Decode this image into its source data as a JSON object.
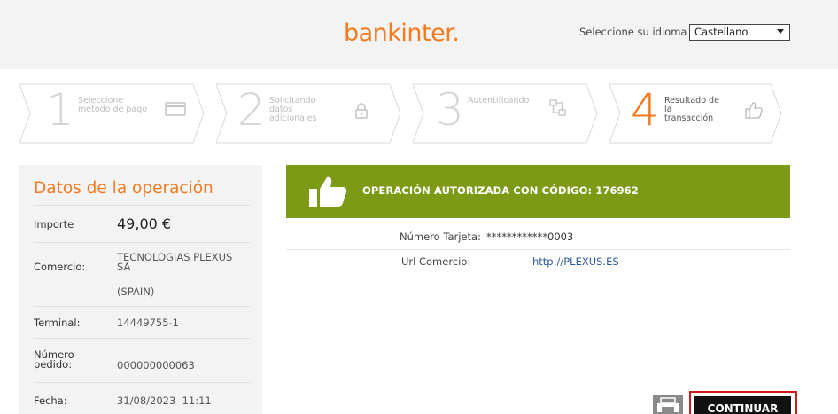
{
  "header": {
    "logo_text": "bankinter.",
    "language_label": "Seleccione su idioma",
    "language_selected": "Castellano"
  },
  "steps": [
    {
      "number": "1",
      "label_lines": [
        "Seleccione",
        "método de pago"
      ],
      "icon": "credit-card-icon",
      "active": false
    },
    {
      "number": "2",
      "label_lines": [
        "Solicitando",
        "datos",
        "adicionales"
      ],
      "icon": "lock-icon",
      "active": false
    },
    {
      "number": "3",
      "label_lines": [
        "Autentificando"
      ],
      "icon": "network-icon",
      "active": false
    },
    {
      "number": "4",
      "label_lines": [
        "Resultado de",
        "la",
        "transacción"
      ],
      "icon": "thumbs-up-icon",
      "active": true
    }
  ],
  "operation": {
    "title": "Datos de la operación",
    "rows": [
      {
        "label": "Importe",
        "value": "49,00 €"
      },
      {
        "label": "Comercio:",
        "value_lines": [
          "TECNOLOGIAS PLEXUS",
          "SA",
          "(SPAIN)"
        ]
      },
      {
        "label": "Terminal:",
        "value": "14449755-1"
      },
      {
        "label_lines": [
          "Número",
          "pedido:"
        ],
        "value": "000000000063"
      },
      {
        "label": "Fecha:",
        "value": "31/08/2023  11:11"
      }
    ]
  },
  "result": {
    "banner_text": "OPERACIÓN AUTORIZADA CON CÓDIGO: 176962",
    "card_label": "Número Tarjeta:",
    "card_value": "************0003",
    "url_label": "Url Comercio:",
    "url_value": "http://PLEXUS.ES"
  },
  "actions": {
    "print_icon": "printer-icon",
    "continue_label": "CONTINUAR"
  },
  "colors": {
    "brand_orange": "#f47a20",
    "success_green": "#7d9a16",
    "panel_gray": "#f3f3f3",
    "highlight_red": "#d11a1a"
  }
}
